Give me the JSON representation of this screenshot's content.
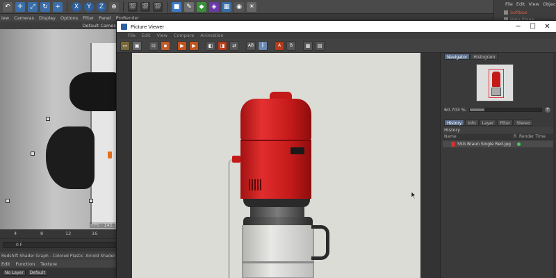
{
  "app": {
    "menubar": [
      "iew",
      "Cameras",
      "Display",
      "Options",
      "Filter",
      "Panel",
      "ProRender"
    ],
    "viewport_camera": "Default Camera",
    "fps": "FPS : 145.1",
    "timeline_ticks": [
      "4",
      "8",
      "12",
      "16"
    ],
    "timeline_field": "0 F",
    "material_tabs": [
      "Redshift Shader Graph - Colored Plastic",
      "Arnold Shader"
    ],
    "material_menu": [
      "Edit",
      "Function",
      "Texture"
    ],
    "layer_buttons": [
      "No Layer",
      "Default"
    ],
    "right_menu": [
      "File",
      "Edit",
      "View",
      "Objects"
    ],
    "objects": [
      {
        "label": "Softbox"
      },
      {
        "label": "Halo Plane"
      }
    ],
    "colors": {
      "accent": "#c41919",
      "panel": "#3b3b3b"
    }
  },
  "picture_viewer": {
    "title": "Picture Viewer",
    "window_controls": {
      "minimize": "─",
      "maximize": "☐",
      "close": "✕"
    },
    "menu": [
      "File",
      "Edit",
      "View",
      "Compare",
      "Animation"
    ],
    "side_tabs_top": [
      "Navigator",
      "Histogram"
    ],
    "zoom_value": "60.703 %",
    "zoom_fraction": 0.2,
    "zoom_plus": "+",
    "side_tabs_bottom": [
      "History",
      "Info",
      "Layer",
      "Filter",
      "Stereo"
    ],
    "history_title": "History",
    "history_columns": [
      "Name",
      "R",
      "Render Time"
    ],
    "history_items": [
      {
        "name": "SSG Braun Single Red.jpg",
        "status": "done"
      }
    ]
  }
}
